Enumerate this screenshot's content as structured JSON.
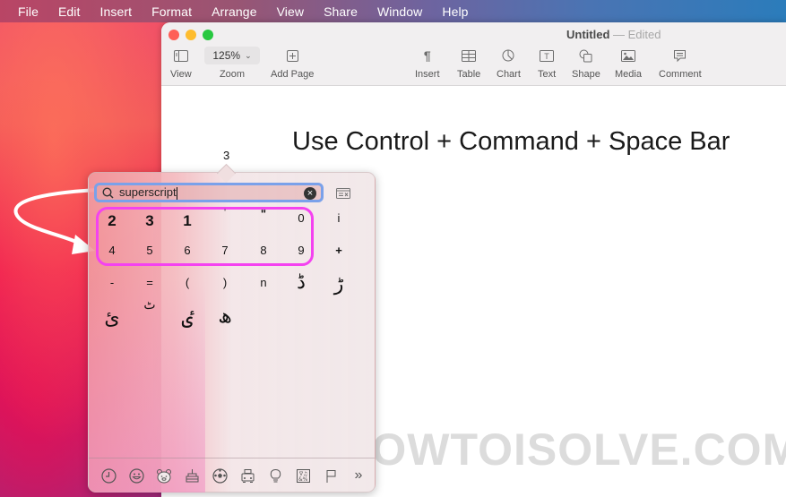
{
  "menubar": {
    "items": [
      "File",
      "Edit",
      "Insert",
      "Format",
      "Arrange",
      "View",
      "Share",
      "Window",
      "Help"
    ]
  },
  "window": {
    "title": "Untitled",
    "title_separator": "—",
    "title_status": "Edited",
    "toolbar": {
      "view": "View",
      "zoom_value": "125%",
      "zoom": "Zoom",
      "add_page": "Add Page",
      "insert": "Insert",
      "table": "Table",
      "chart": "Chart",
      "text": "Text",
      "shape": "Shape",
      "media": "Media",
      "comment": "Comment"
    },
    "document": {
      "heading": "Use Control + Command + Space Bar"
    }
  },
  "character_viewer": {
    "preview_char": "3",
    "search_value": "superscript",
    "results_row1": [
      "2",
      "3",
      "1",
      "ˈ",
      "ʺ",
      "0",
      "i"
    ],
    "results_row2": [
      "4",
      "5",
      "6",
      "7",
      "8",
      "9",
      "+"
    ],
    "results_row3": [
      "-",
      "=",
      "(",
      ")",
      "n",
      "ڈ",
      "ڑ"
    ],
    "results_row4": [
      "ئ",
      "ٹ",
      "ٸ",
      "ھ"
    ],
    "categories": [
      "Frequently Used",
      "Smileys & People",
      "Animals & Nature",
      "Food & Drink",
      "Activity",
      "Travel & Places",
      "Objects",
      "Symbols",
      "Flags",
      "More"
    ]
  },
  "watermark": "(C) HOWTOISOLVE.COM",
  "colors": {
    "highlight": "#f442f0",
    "search_focus": "#7aa1ea"
  }
}
